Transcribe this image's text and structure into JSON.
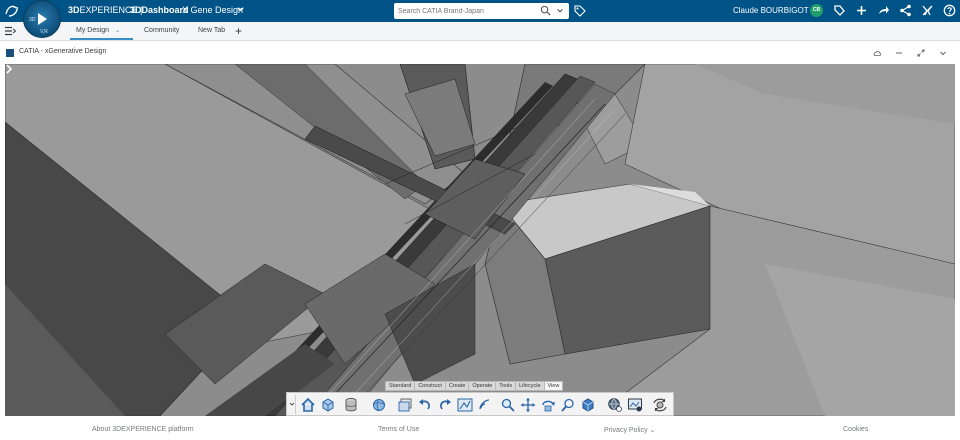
{
  "topbar": {
    "brand_bold": "3D",
    "brand_rest": "EXPERIENCE | ",
    "app_name": "3DDashboard",
    "dashboard_name": "X Gene Design",
    "search_placeholder": "Search CATIA Brand-Japan",
    "user_name": "Claude BOURBIGOT",
    "user_initials": "CB",
    "compass_labels": [
      "3D",
      "V,R"
    ]
  },
  "tabs": [
    {
      "label": "My Design",
      "active": true
    },
    {
      "label": "Community",
      "active": false
    },
    {
      "label": "New Tab",
      "active": false
    }
  ],
  "widget": {
    "title": "CATIA - xGenerative Design"
  },
  "toolbar": {
    "section_tabs": [
      "Standard",
      "Construct",
      "Create",
      "Operate",
      "Tools",
      "Lifecycle",
      "View"
    ],
    "active_section": "View",
    "tools": [
      "home-view-icon",
      "view-cube-icon",
      "database-icon",
      "render-sphere-icon",
      "layers-icon",
      "undo-icon",
      "redo-icon",
      "fit-all-icon",
      "signal-icon",
      "zoom-icon",
      "pan-icon",
      "rotate-icon",
      "zoom-area-icon",
      "shading-icon",
      "globe-search-icon",
      "capture-icon",
      "settings-rotate-icon"
    ]
  },
  "footer": {
    "about": "About 3DEXPERIENCE platform",
    "terms": "Terms of Use",
    "privacy": "Privacy Policy",
    "cookies": "Cookies"
  },
  "colors": {
    "topbar": "#005386",
    "accent": "#368ec4",
    "avatar": "#1f9e6a"
  }
}
